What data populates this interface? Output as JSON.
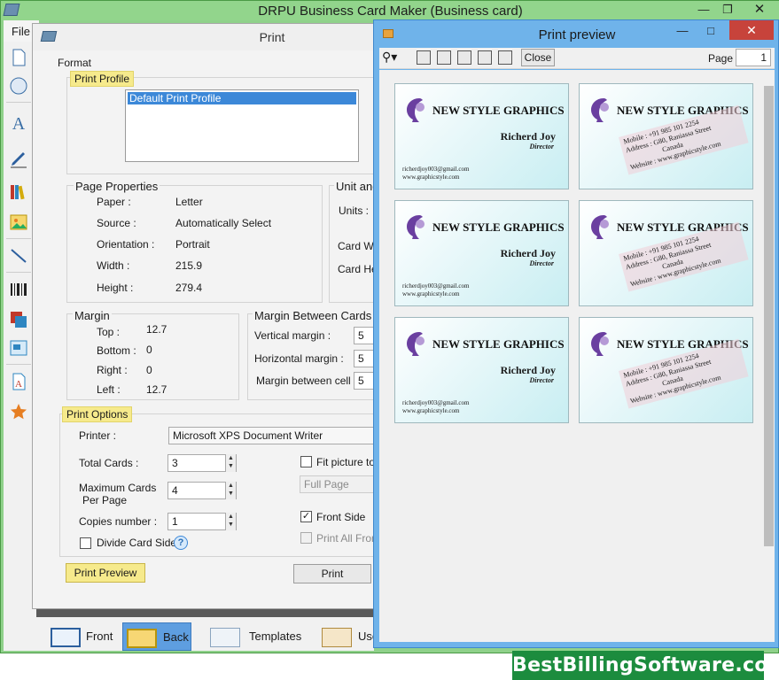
{
  "app": {
    "title": "DRPU Business Card Maker (Business card)"
  },
  "menu": {
    "file": "File"
  },
  "print_dialog": {
    "title": "Print",
    "format_label": "Format",
    "print_profile": {
      "label": "Print Profile",
      "selected": "Default Print Profile"
    },
    "page_properties": {
      "label": "Page Properties",
      "rows": [
        {
          "key": "Paper :",
          "value": "Letter"
        },
        {
          "key": "Source :",
          "value": "Automatically Select"
        },
        {
          "key": "Orientation :",
          "value": "Portrait"
        },
        {
          "key": "Width :",
          "value": "215.9"
        },
        {
          "key": "Height :",
          "value": "279.4"
        }
      ]
    },
    "unit": {
      "label": "Unit and",
      "units": "Units :",
      "card_width": "Card Wi",
      "card_height": "Card He"
    },
    "margin": {
      "label": "Margin",
      "rows": [
        {
          "key": "Top :",
          "value": "12.7"
        },
        {
          "key": "Bottom :",
          "value": "0"
        },
        {
          "key": "Right :",
          "value": "0"
        },
        {
          "key": "Left :",
          "value": "12.7"
        }
      ]
    },
    "margin_between": {
      "label": "Margin Between Cards",
      "rows": [
        {
          "key": "Vertical margin :",
          "value": "5"
        },
        {
          "key": "Horizontal margin :",
          "value": "5"
        },
        {
          "key": "Margin between cell :",
          "value": "5"
        }
      ]
    },
    "print_options": {
      "label": "Print Options",
      "printer_label": "Printer :",
      "printer_value": "Microsoft XPS Document Writer",
      "total_cards_label": "Total Cards :",
      "total_cards_value": "3",
      "max_cards_label_1": "Maximum Cards",
      "max_cards_label_2": "Per Page",
      "max_cards_value": "4",
      "copies_label": "Copies number :",
      "copies_value": "1",
      "divide_card_side": "Divide Card Side",
      "fit_picture": "Fit picture to",
      "full_page": "Full Page",
      "front_side": "Front Side",
      "print_all_from": "Print All From"
    },
    "buttons": {
      "print_preview": "Print Preview",
      "print": "Print"
    }
  },
  "bottom_tabs": [
    {
      "label": "Front"
    },
    {
      "label": "Back"
    },
    {
      "label": "Templates"
    },
    {
      "label": "Use"
    }
  ],
  "preview": {
    "title": "Print preview",
    "close_label": "Close",
    "page_label": "Page",
    "page_value": "1",
    "front_card": {
      "brand": "NEW STYLE GRAPHICS",
      "name": "Richerd Joy",
      "role": "Director",
      "email": "richerdjoy003@gmail.com",
      "web": "www.graphicstyle.com"
    },
    "back_card": {
      "brand": "NEW STYLE GRAPHICS",
      "mobile": "Mobile   : +91 985 101 2254",
      "address": "Address : G80, Raniassa Street",
      "country": "Canada",
      "website": "Website : www.graphicstyle.com"
    }
  },
  "banner": {
    "text": "BestBillingSoftware.com"
  },
  "colors": {
    "title_bar": "#92d58c",
    "preview_frame": "#6fb3ea",
    "highlight": "#f6ea8c",
    "banner": "#1c8c3e",
    "close_red": "#c7433b"
  }
}
